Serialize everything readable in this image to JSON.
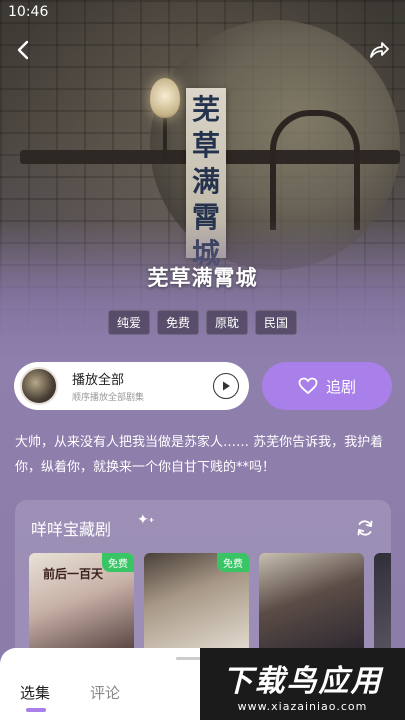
{
  "status_bar": {
    "time": "10:46"
  },
  "hero": {
    "banner_chars": [
      "芜",
      "草",
      "满",
      "霄",
      "城"
    ]
  },
  "drama": {
    "title": "芜草满霄城",
    "tags": [
      "纯爱",
      "免费",
      "原耽",
      "民国"
    ],
    "description": "大帅，从来没有人把我当做是苏家人…… 苏芜你告诉我，我护着你，纵着你，就换来一个你自甘下贱的**吗！"
  },
  "play_all": {
    "title": "播放全部",
    "subtitle": "顺序播放全部剧集"
  },
  "follow": {
    "label": "追剧"
  },
  "collection": {
    "title": "咩咩宝藏剧",
    "items": [
      {
        "badge": "免费",
        "cover_text": "前后一百天"
      },
      {
        "badge": "免费",
        "cover_text": ""
      },
      {
        "badge": "",
        "cover_text": ""
      },
      {
        "badge": "",
        "cover_text": ""
      }
    ]
  },
  "bottom_tabs": [
    {
      "label": "选集",
      "active": true
    },
    {
      "label": "评论",
      "active": false
    }
  ],
  "watermark": {
    "text": "下载鸟应用",
    "url": "www.xiazainiao.com"
  },
  "colors": {
    "accent": "#a980ea",
    "free_badge": "#39c566",
    "background": "#8e7fad"
  },
  "icons": {
    "back": "chevron-left-icon",
    "share": "share-icon",
    "play": "play-icon",
    "heart": "heart-icon",
    "refresh": "refresh-icon",
    "sparkle": "sparkle-icon"
  }
}
